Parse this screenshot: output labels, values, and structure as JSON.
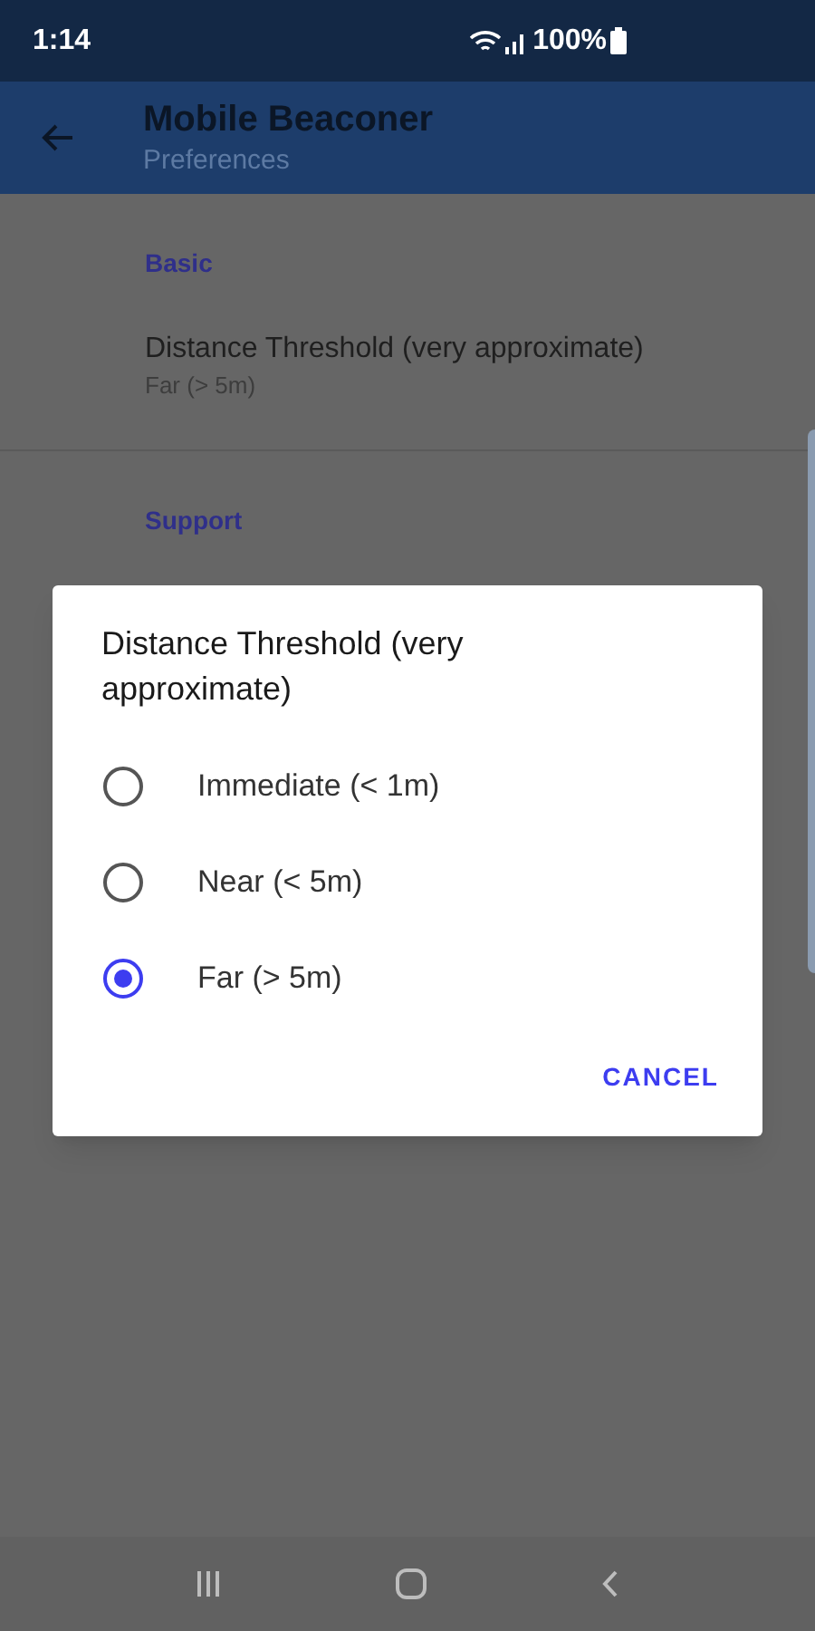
{
  "status_bar": {
    "time": "1:14",
    "battery": "100%"
  },
  "app_bar": {
    "title": "Mobile Beaconer",
    "subtitle": "Preferences"
  },
  "sections": [
    {
      "header": "Basic",
      "items": [
        {
          "title": "Distance Threshold (very approximate)",
          "summary": "Far (> 5m)"
        }
      ]
    },
    {
      "header": "Support"
    }
  ],
  "dialog": {
    "title": "Distance Threshold (very approximate)",
    "options": [
      {
        "label": "Immediate (< 1m)",
        "selected": false
      },
      {
        "label": "Near (< 5m)",
        "selected": false
      },
      {
        "label": "Far (> 5m)",
        "selected": true
      }
    ],
    "buttons": [
      "CANCEL"
    ]
  }
}
